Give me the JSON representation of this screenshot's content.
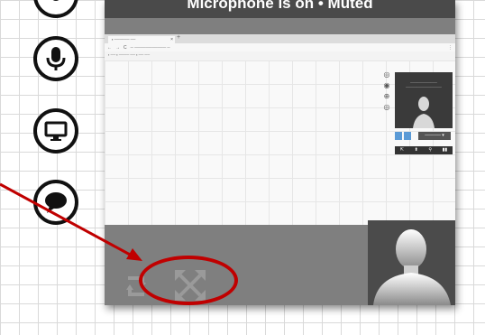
{
  "window": {
    "title": "Microphone is on  •  Muted"
  },
  "left_toolbar": [
    {
      "icon": "top-partial-icon"
    },
    {
      "icon": "microphone-icon"
    },
    {
      "icon": "monitor-icon"
    },
    {
      "icon": "chat-bubble-icon"
    }
  ],
  "browser": {
    "tab_label": "▪ ────── ──",
    "tab_close": "×",
    "new_tab": "+",
    "nav_back": "←",
    "nav_forward": "→",
    "nav_reload": "C",
    "url": "─ ─────────── ─",
    "menu": "⋮",
    "bookmarks": "▪ ── ▪ ──── ── ▪ ── ──"
  },
  "mini_panel": {
    "caption": "──────────── ────────────────",
    "dropdown_label": "───── ▾",
    "controls": [
      "⇱",
      "⬍",
      "⚲",
      "▮▮"
    ]
  },
  "side_icons": [
    "◎",
    "◉",
    "⊕",
    "◎"
  ],
  "colors": {
    "accent_highlight": "#c00000",
    "mini_button_blue": "#5a9ad6",
    "window_bg": "#7f7f7f",
    "title_bar": "#4a4a4a"
  }
}
